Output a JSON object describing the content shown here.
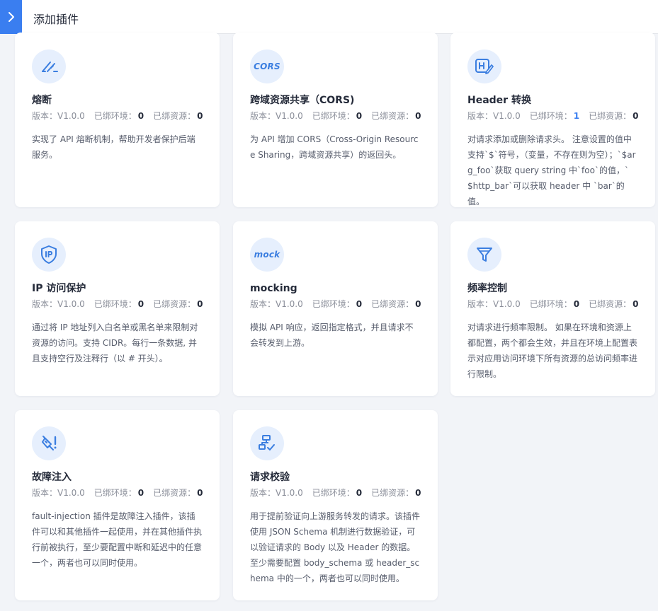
{
  "header": {
    "title": "添加插件"
  },
  "meta_labels": {
    "version": "版本：",
    "env": "已绑环境：",
    "res": "已绑资源："
  },
  "cards": [
    {
      "title": "熔断",
      "version": "V1.0.0",
      "env": "0",
      "res": "0",
      "icon": "circuit-breaker-icon",
      "desc": "实现了 API 熔断机制，帮助开发者保护后端服务。"
    },
    {
      "title": "跨域资源共享（CORS)",
      "version": "V1.0.0",
      "env": "0",
      "res": "0",
      "icon": "cors-icon",
      "icon_text": "CORS",
      "desc": "为 API 增加 CORS（Cross-Origin Resource Sharing，跨域资源共享）的返回头。"
    },
    {
      "title": "Header 转换",
      "version": "V1.0.0",
      "env": "1",
      "res": "0",
      "icon": "header-icon",
      "desc": "对请求添加或删除请求头。 注意设置的值中支持`$`符号，（变量，不存在则为空）；`$arg_foo`获取 query string 中`foo`的值，`$http_bar`可以获取 header 中 `bar`的值。"
    },
    {
      "title": "IP 访问保护",
      "version": "V1.0.0",
      "env": "0",
      "res": "0",
      "icon": "ip-shield-icon",
      "desc": "通过将 IP 地址列入白名单或黑名单来限制对资源的访问。支持 CIDR。每行一条数据, 并且支持空行及注释行（以 # 开头）。"
    },
    {
      "title": "mocking",
      "version": "V1.0.0",
      "env": "0",
      "res": "0",
      "icon": "mock-icon",
      "icon_text": "mock",
      "desc": "模拟 API 响应，返回指定格式，并且请求不会转发到上游。"
    },
    {
      "title": "频率控制",
      "version": "V1.0.0",
      "env": "0",
      "res": "0",
      "icon": "filter-icon",
      "desc": "对请求进行频率限制。 如果在环境和资源上都配置，两个都会生效，并且在环境上配置表示对应用访问环境下所有资源的总访问频率进行限制。"
    },
    {
      "title": "故障注入",
      "version": "V1.0.0",
      "env": "0",
      "res": "0",
      "icon": "syringe-icon",
      "desc": "fault-injection 插件是故障注入插件，该插件可以和其他插件一起使用，并在其他插件执行前被执行，至少要配置中断和延迟中的任意一个，两者也可以同时使用。"
    },
    {
      "title": "请求校验",
      "version": "V1.0.0",
      "env": "0",
      "res": "0",
      "icon": "request-validation-icon",
      "desc": "用于提前验证向上游服务转发的请求。该插件使用 JSON Schema 机制进行数据验证，可以验证请求的 Body 以及 Header 的数据。至少需要配置 body_schema 或 header_schema 中的一个，两者也可以同时使用。"
    }
  ],
  "colors": {
    "accent": "#3a7ef0",
    "icon_bg": "#e6effd",
    "background": "#f2f4f8"
  }
}
